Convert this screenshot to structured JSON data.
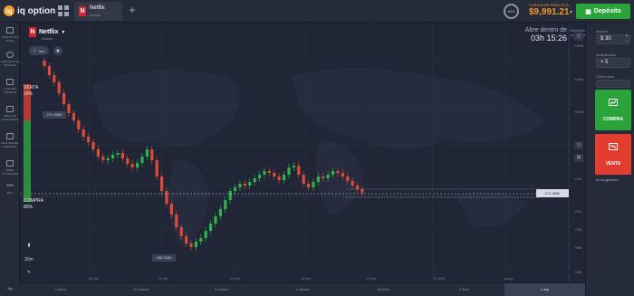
{
  "header": {
    "logo_mark": "iq",
    "logo_text": "iq option",
    "tab": {
      "badge": "N",
      "name": "Netflix",
      "type": "Acción"
    },
    "add_tab": "+",
    "pct": "60%",
    "account_label": "CUENTA DE PRÁCTICA",
    "balance": "$9,991.21",
    "deposit": "Depósito"
  },
  "sidebar": [
    {
      "label": "PORTAFOLIO TOTAL"
    },
    {
      "label": "HISTORIAL DE TRADING"
    },
    {
      "label": "CHAT DE SOPORTE"
    },
    {
      "label": "TABLA DE POSICIONES"
    },
    {
      "label": "ANÁLISIS DEL MERCADO"
    },
    {
      "label": "VIDEO TUTORIALES"
    },
    {
      "label": "MÁS"
    }
  ],
  "asset": {
    "badge": "N",
    "name": "Netflix",
    "caret": "▼",
    "type": "Acción",
    "info": "Info",
    "star": "★"
  },
  "expiry": {
    "label": "Abre dentro de",
    "time": "03h 15:26"
  },
  "benefit_label": "Beneficio potencial",
  "sentiment": {
    "sell_label": "VENTA",
    "sell_pct": "20%",
    "buy_label": "COMPRA",
    "buy_pct": "80%"
  },
  "price": {
    "current": "271.3850",
    "hover": "271.9650",
    "low": "246.7630"
  },
  "y_ticks": [
    "+18%",
    "+14%",
    "+10%",
    "+5%",
    "+1%",
    "+1%",
    "+1%",
    "+5%",
    "+9%"
  ],
  "x_ticks": [
    "25 abr",
    "01 abr",
    "08 abr",
    "15 abr",
    "22 abr",
    "02 ABR",
    "mayo"
  ],
  "right_panel": {
    "amount_label": "Importe",
    "amount": "$ 30",
    "mult_label": "Multiplicador",
    "mult": "× 5",
    "auto_close_label": "Cierre auto",
    "buy": "COMPRA",
    "sell": "VENTA",
    "opening": "en la apertura"
  },
  "left_tools": {
    "timeframe": "30m"
  },
  "periods": [
    "2 años",
    "12 meses",
    "6 meses",
    "3 meses",
    "30 días",
    "7 días",
    "1 día"
  ],
  "active_period": "1 día",
  "colors": {
    "up": "#2bb54a",
    "down": "#e04a3a",
    "deposit": "#2ba33b",
    "accent": "#f39a2b"
  },
  "chart_data": {
    "type": "candlestick",
    "candles_approx": [
      [
        325,
        318,
        328,
        312
      ],
      [
        318,
        305,
        320,
        300
      ],
      [
        305,
        298,
        308,
        295
      ],
      [
        298,
        290,
        300,
        286
      ],
      [
        290,
        283,
        292,
        280
      ],
      [
        283,
        276,
        285,
        272
      ],
      [
        276,
        270,
        278,
        266
      ],
      [
        270,
        272,
        275,
        268
      ],
      [
        272,
        268,
        276,
        265
      ],
      [
        268,
        262,
        270,
        258
      ],
      [
        262,
        258,
        265,
        254
      ],
      [
        258,
        252,
        260,
        248
      ],
      [
        252,
        250,
        256,
        246
      ],
      [
        250,
        248,
        253,
        244
      ],
      [
        248,
        251,
        254,
        246
      ],
      [
        251,
        249,
        253,
        246
      ]
    ]
  }
}
